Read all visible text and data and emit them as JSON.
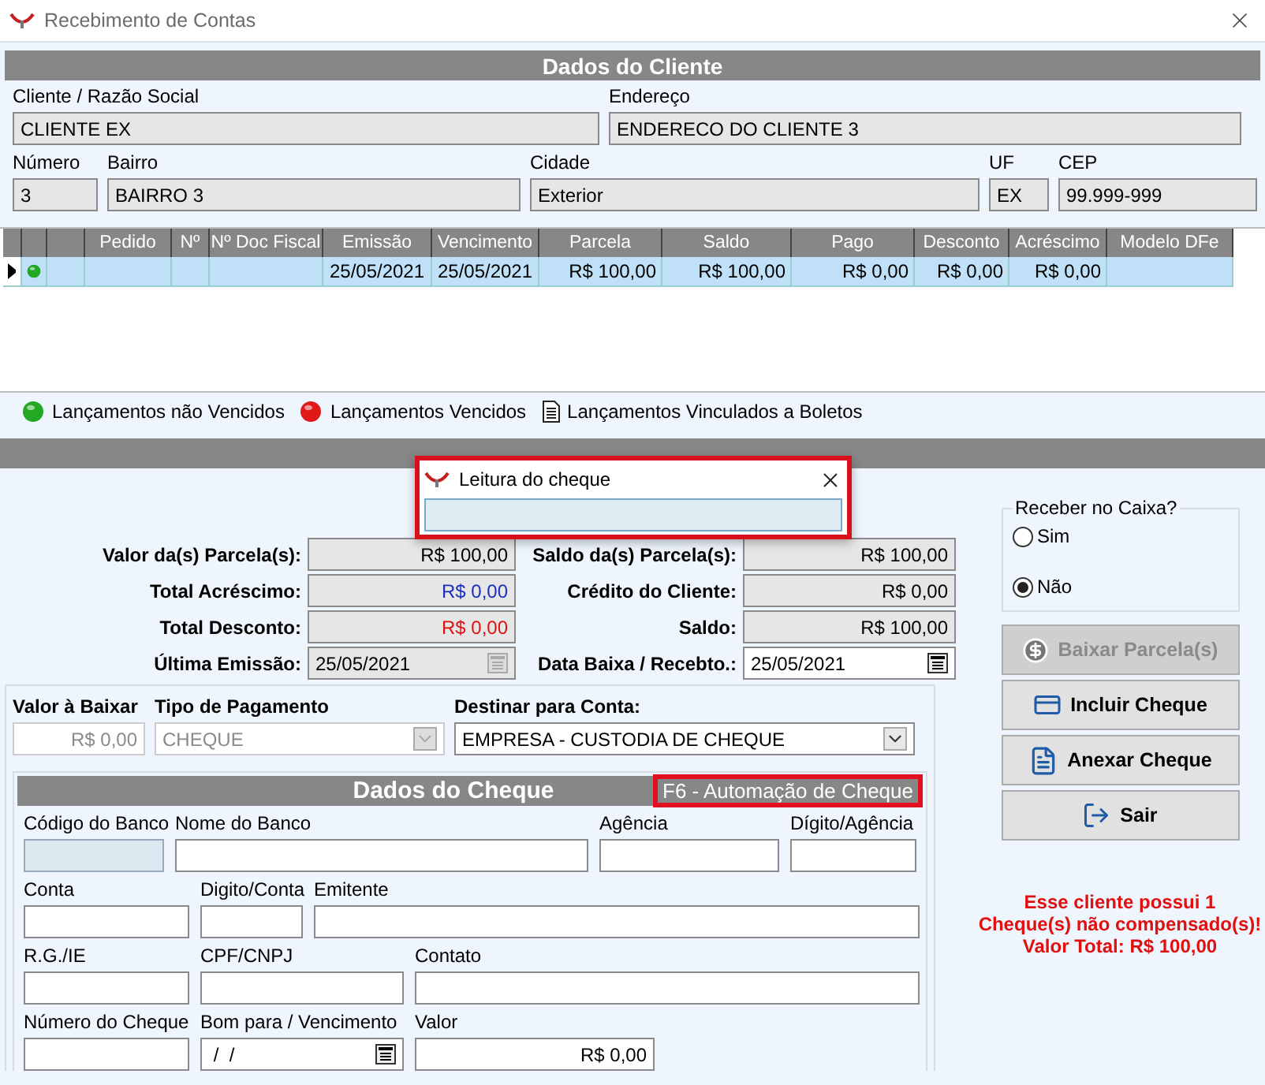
{
  "window": {
    "title": "Recebimento de Contas"
  },
  "client": {
    "header": "Dados do Cliente",
    "name": {
      "label": "Cliente / Razão Social",
      "value": "CLIENTE EX"
    },
    "address": {
      "label": "Endereço",
      "value": "ENDERECO DO CLIENTE 3"
    },
    "number": {
      "label": "Número",
      "value": "3"
    },
    "district": {
      "label": "Bairro",
      "value": "BAIRRO 3"
    },
    "city": {
      "label": "Cidade",
      "value": "Exterior"
    },
    "state": {
      "label": "UF",
      "value": "EX"
    },
    "zip": {
      "label": "CEP",
      "value": "99.999-999"
    }
  },
  "grid": {
    "columns": [
      {
        "kind": "pointer"
      },
      {
        "kind": "status"
      },
      {
        "kind": "text"
      },
      {
        "label": "Pedido",
        "kind": "text"
      },
      {
        "label": "Nº",
        "kind": "text"
      },
      {
        "label": "Nº Doc Fiscal",
        "kind": "text"
      },
      {
        "label": "Emissão",
        "kind": "date"
      },
      {
        "label": "Vencimento",
        "kind": "date"
      },
      {
        "label": "Parcela",
        "kind": "money"
      },
      {
        "label": "Saldo",
        "kind": "money"
      },
      {
        "label": "Pago",
        "kind": "money"
      },
      {
        "label": "Desconto",
        "kind": "money"
      },
      {
        "label": "Acréscimo",
        "kind": "money"
      },
      {
        "label": "Modelo DFe",
        "kind": "text"
      }
    ],
    "rows": [
      {
        "selected": true,
        "overdue": false,
        "cells": [
          "",
          "",
          "",
          "",
          "",
          "",
          "25/05/2021",
          "25/05/2021",
          "R$ 100,00",
          "R$ 100,00",
          "R$ 0,00",
          "R$ 0,00",
          "R$ 0,00",
          ""
        ]
      }
    ]
  },
  "legend": [
    {
      "kind": "dot",
      "color": "#22a822",
      "label": "Lançamentos não Vencidos"
    },
    {
      "kind": "dot",
      "color": "#e01818",
      "label": "Lançamentos Vencidos"
    },
    {
      "kind": "document",
      "label": "Lançamentos Vinculados a Boletos"
    }
  ],
  "parcel": {
    "left": [
      {
        "label": "Valor da(s) Parcela(s):",
        "value": "R$ 100,00",
        "color": "#000000",
        "kind": "text"
      },
      {
        "label": "Total Acréscimo:",
        "value": "R$ 0,00",
        "color": "#1a2ec0",
        "kind": "text"
      },
      {
        "label": "Total Desconto:",
        "value": "R$ 0,00",
        "color": "#e01010",
        "kind": "text"
      },
      {
        "label": "Última Emissão:",
        "value": "25/05/2021",
        "color": "#000000",
        "kind": "date",
        "disabled": true
      }
    ],
    "right": [
      {
        "label": "Saldo da(s) Parcela(s):",
        "value": "R$ 100,00",
        "color": "#000000",
        "kind": "text"
      },
      {
        "label": "Crédito do Cliente:",
        "value": "R$ 0,00",
        "color": "#000000",
        "kind": "text"
      },
      {
        "label": "Saldo:",
        "value": "R$ 100,00",
        "color": "#000000",
        "kind": "text"
      },
      {
        "label": "Data Baixa / Recebto.:",
        "value": "25/05/2021",
        "color": "#000000",
        "kind": "date",
        "disabled": false
      }
    ]
  },
  "payment": [
    {
      "label": "Valor à Baixar",
      "value": "R$ 0,00",
      "kind": "text",
      "disabled": true
    },
    {
      "label": "Tipo de Pagamento",
      "value": "CHEQUE",
      "kind": "select",
      "disabled": true
    },
    {
      "label": "Destinar para Conta:",
      "value": "EMPRESA - CUSTODIA DE CHEQUE",
      "kind": "select",
      "disabled": false
    }
  ],
  "cheque": {
    "header": "Dados do Cheque",
    "shortcut": "F6 - Automação de Cheque",
    "rows": [
      [
        {
          "label": "Código do Banco",
          "highlighted": true,
          "kind": "text"
        },
        {
          "label": "Nome do Banco",
          "highlighted": false,
          "kind": "text"
        },
        {
          "label": "Agência",
          "highlighted": false,
          "kind": "text"
        },
        {
          "label": "Dígito/Agência",
          "highlighted": false,
          "kind": "text"
        }
      ],
      [
        {
          "label": "Conta",
          "highlighted": false,
          "kind": "text"
        },
        {
          "label": "Digito/Conta",
          "highlighted": false,
          "kind": "text"
        },
        {
          "label": "Emitente",
          "highlighted": false,
          "kind": "text"
        }
      ],
      [
        {
          "label": "R.G./IE",
          "highlighted": false,
          "kind": "text"
        },
        {
          "label": "CPF/CNPJ",
          "highlighted": false,
          "kind": "text"
        },
        {
          "label": "Contato",
          "highlighted": false,
          "kind": "text"
        }
      ],
      [
        {
          "label": "Número do Cheque",
          "highlighted": false,
          "kind": "text"
        },
        {
          "label": "Bom para / Vencimento",
          "value": " /  /",
          "highlighted": false,
          "kind": "date"
        },
        {
          "label": "Valor",
          "value": "R$ 0,00",
          "highlighted": false,
          "kind": "money"
        }
      ]
    ]
  },
  "receive_at_cashier": {
    "title": "Receber no Caixa?",
    "options": [
      {
        "label": "Sim",
        "selected": false
      },
      {
        "label": "Não",
        "selected": true
      }
    ]
  },
  "buttons": [
    {
      "label": "Baixar Parcela(s)",
      "disabled": true
    },
    {
      "label": "Incluir Cheque",
      "disabled": false
    },
    {
      "label": "Anexar Cheque",
      "disabled": false
    },
    {
      "label": "Sair",
      "disabled": false
    }
  ],
  "alert": [
    "Esse cliente possui 1",
    "Cheque(s) não compensado(s)!",
    "Valor Total: R$ 100,00"
  ],
  "dialog": {
    "title": "Leitura do cheque"
  }
}
